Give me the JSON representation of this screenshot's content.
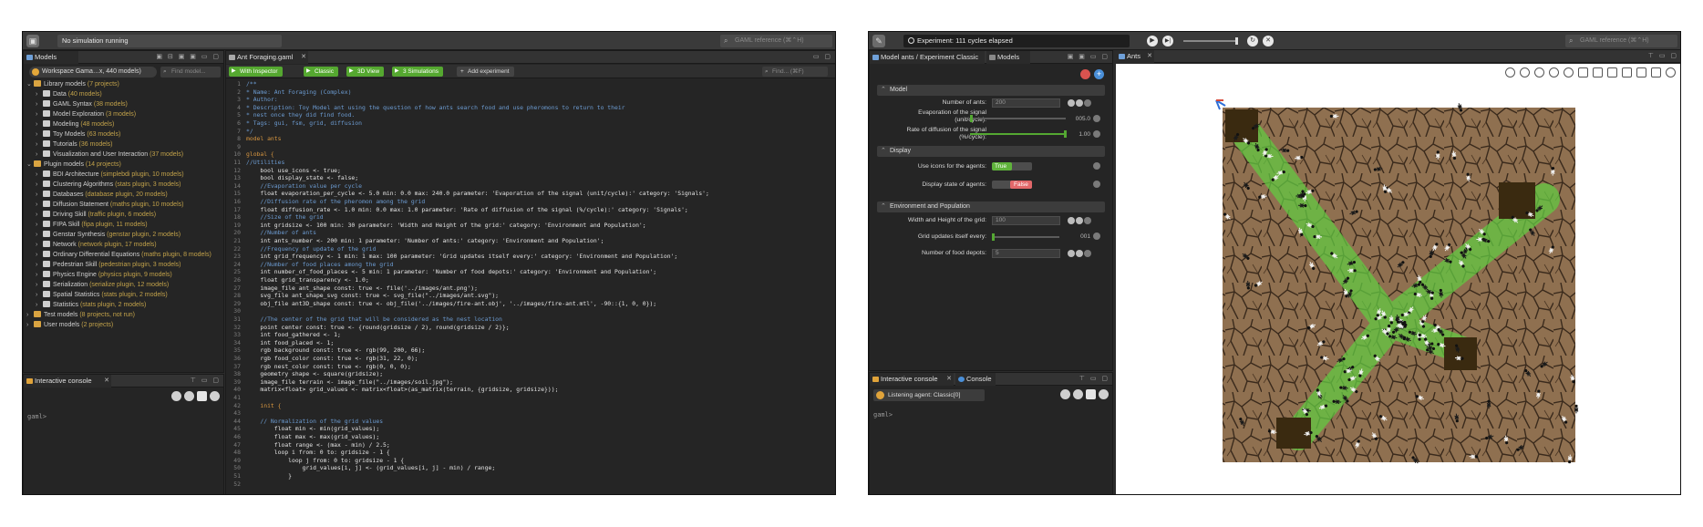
{
  "left_window": {
    "status": "No simulation running",
    "search_placeholder": "GAML reference (⌘⌃H)",
    "models_tab": "Models",
    "workspace": "Workspace Gama…x, 440 models)",
    "find_model_placeholder": "Find model...",
    "tree": [
      {
        "indent": 0,
        "twisty": "⌄",
        "label": "Library models",
        "count": "(7 projects)",
        "folder": true
      },
      {
        "indent": 1,
        "twisty": "›",
        "label": "Data",
        "count": "(40 models)"
      },
      {
        "indent": 1,
        "twisty": "›",
        "label": "GAML Syntax",
        "count": "(38 models)"
      },
      {
        "indent": 1,
        "twisty": "›",
        "label": "Model Exploration",
        "count": "(3 models)"
      },
      {
        "indent": 1,
        "twisty": "›",
        "label": "Modeling",
        "count": "(48 models)"
      },
      {
        "indent": 1,
        "twisty": "›",
        "label": "Toy Models",
        "count": "(63 models)"
      },
      {
        "indent": 1,
        "twisty": "›",
        "label": "Tutorials",
        "count": "(36 models)"
      },
      {
        "indent": 1,
        "twisty": "›",
        "label": "Visualization and User Interaction",
        "count": "(37 models)"
      },
      {
        "indent": 0,
        "twisty": "⌄",
        "label": "Plugin models",
        "count": "(14 projects)",
        "folder": true
      },
      {
        "indent": 1,
        "twisty": "›",
        "label": "BDI Architecture",
        "count": "(simplebdi plugin, 10 models)"
      },
      {
        "indent": 1,
        "twisty": "›",
        "label": "Clustering Algorithms",
        "count": "(stats plugin, 3 models)"
      },
      {
        "indent": 1,
        "twisty": "›",
        "label": "Databases",
        "count": "(database plugin, 20 models)"
      },
      {
        "indent": 1,
        "twisty": "›",
        "label": "Diffusion Statement",
        "count": "(maths plugin, 10 models)"
      },
      {
        "indent": 1,
        "twisty": "›",
        "label": "Driving Skill",
        "count": "(traffic plugin, 6 models)"
      },
      {
        "indent": 1,
        "twisty": "›",
        "label": "FIPA Skill",
        "count": "(fipa plugin, 11 models)"
      },
      {
        "indent": 1,
        "twisty": "›",
        "label": "Genstar Synthesis",
        "count": "(genstar plugin, 2 models)"
      },
      {
        "indent": 1,
        "twisty": "›",
        "label": "Network",
        "count": "(network plugin, 17 models)"
      },
      {
        "indent": 1,
        "twisty": "›",
        "label": "Ordinary Differential Equations",
        "count": "(maths plugin, 8 models)"
      },
      {
        "indent": 1,
        "twisty": "›",
        "label": "Pedestrian Skill",
        "count": "(pedestrian plugin, 3 models)"
      },
      {
        "indent": 1,
        "twisty": "›",
        "label": "Physics Engine",
        "count": "(physics plugin, 9 models)"
      },
      {
        "indent": 1,
        "twisty": "›",
        "label": "Serialization",
        "count": "(serialize plugin, 12 models)"
      },
      {
        "indent": 1,
        "twisty": "›",
        "label": "Spatial Statistics",
        "count": "(stats plugin, 2 models)"
      },
      {
        "indent": 1,
        "twisty": "›",
        "label": "Statistics",
        "count": "(stats plugin, 2 models)"
      },
      {
        "indent": 0,
        "twisty": "›",
        "label": "Test models",
        "count": "(8 projects, not run)",
        "folder": true
      },
      {
        "indent": 0,
        "twisty": "›",
        "label": "User models",
        "count": "(2 projects)",
        "folder": true
      }
    ],
    "console_tab": "Interactive console",
    "console_prompt": "gaml>",
    "editor_tab": "Ant Foraging.gaml",
    "experiments": [
      "With Inspector",
      "Classic",
      "3D View",
      "3 Simulations"
    ],
    "add_experiment": "Add experiment",
    "find_placeholder": "Find... (⌘F)",
    "code": [
      {
        "n": "1",
        "t": "/**",
        "c": "com"
      },
      {
        "n": "2",
        "t": "* Name: Ant Foraging (Complex)",
        "c": "com"
      },
      {
        "n": "3",
        "t": "* Author:",
        "c": "com"
      },
      {
        "n": "4",
        "t": "* Description: Toy Model ant using the question of how ants search food and use pheromons to return to their",
        "c": "com"
      },
      {
        "n": "5",
        "t": "* nest once they did find food.",
        "c": "com"
      },
      {
        "n": "6",
        "t": "* Tags: gui, fsm, grid, diffusion",
        "c": "com"
      },
      {
        "n": "7",
        "t": "*/",
        "c": "com"
      },
      {
        "n": "8",
        "t": "model ants",
        "c": "kw"
      },
      {
        "n": "9",
        "t": "",
        "c": "txt"
      },
      {
        "n": "10",
        "t": "global {",
        "c": "kw"
      },
      {
        "n": "11",
        "t": "//Utilities",
        "c": "com"
      },
      {
        "n": "12",
        "t": "    bool use_icons <- true;",
        "c": "txt"
      },
      {
        "n": "13",
        "t": "    bool display_state <- false;",
        "c": "txt"
      },
      {
        "n": "14",
        "t": "    //Evaporation value per cycle",
        "c": "com"
      },
      {
        "n": "15",
        "t": "    float evaporation_per_cycle <- 5.0 min: 0.0 max: 240.0 parameter: 'Evaporation of the signal (unit/cycle):' category: 'Signals';",
        "c": "txt"
      },
      {
        "n": "16",
        "t": "    //Diffusion rate of the pheromon among the grid",
        "c": "com"
      },
      {
        "n": "17",
        "t": "    float diffusion_rate <- 1.0 min: 0.0 max: 1.0 parameter: 'Rate of diffusion of the signal (%/cycle):' category: 'Signals';",
        "c": "txt"
      },
      {
        "n": "18",
        "t": "    //Size of the grid",
        "c": "com"
      },
      {
        "n": "19",
        "t": "    int gridsize <- 100 min: 30 parameter: 'Width and Height of the grid:' category: 'Environment and Population';",
        "c": "txt"
      },
      {
        "n": "20",
        "t": "    //Number of ants",
        "c": "com"
      },
      {
        "n": "21",
        "t": "    int ants_number <- 200 min: 1 parameter: 'Number of ants:' category: 'Environment and Population';",
        "c": "txt"
      },
      {
        "n": "22",
        "t": "    //Frequency of update of the grid",
        "c": "com"
      },
      {
        "n": "23",
        "t": "    int grid_frequency <- 1 min: 1 max: 100 parameter: 'Grid updates itself every:' category: 'Environment and Population';",
        "c": "txt"
      },
      {
        "n": "24",
        "t": "    //Number of food places among the grid",
        "c": "com"
      },
      {
        "n": "25",
        "t": "    int number_of_food_places <- 5 min: 1 parameter: 'Number of food depots:' category: 'Environment and Population';",
        "c": "txt"
      },
      {
        "n": "26",
        "t": "    float grid_transparency <- 1.0;",
        "c": "txt"
      },
      {
        "n": "27",
        "t": "    image_file ant_shape const: true <- file('../images/ant.png');",
        "c": "txt"
      },
      {
        "n": "28",
        "t": "    svg_file ant_shape_svg const: true <- svg_file(\"../images/ant.svg\");",
        "c": "txt"
      },
      {
        "n": "29",
        "t": "    obj_file ant3D_shape const: true <- obj_file('../images/fire-ant.obj', '../images/fire-ant.mtl', -90::{1, 0, 0});",
        "c": "txt"
      },
      {
        "n": "30",
        "t": "",
        "c": "txt"
      },
      {
        "n": "31",
        "t": "    //The center of the grid that will be considered as the nest location",
        "c": "com"
      },
      {
        "n": "32",
        "t": "    point center const: true <- {round(gridsize / 2), round(gridsize / 2)};",
        "c": "txt"
      },
      {
        "n": "33",
        "t": "    int food_gathered <- 1;",
        "c": "txt"
      },
      {
        "n": "34",
        "t": "    int food_placed <- 1;",
        "c": "txt"
      },
      {
        "n": "35",
        "t": "    rgb background const: true <- rgb(99, 200, 66);",
        "c": "txt"
      },
      {
        "n": "36",
        "t": "    rgb food_color const: true <- rgb(31, 22, 0);",
        "c": "txt"
      },
      {
        "n": "37",
        "t": "    rgb nest_color const: true <- rgb(0, 0, 0);",
        "c": "txt"
      },
      {
        "n": "38",
        "t": "    geometry shape <- square(gridsize);",
        "c": "txt"
      },
      {
        "n": "39",
        "t": "    image_file terrain <- image_file(\"../images/soil.jpg\");",
        "c": "txt"
      },
      {
        "n": "40",
        "t": "    matrix<float> grid_values <- matrix<float>(as_matrix(terrain, {gridsize, gridsize}));",
        "c": "txt"
      },
      {
        "n": "41",
        "t": "",
        "c": "txt"
      },
      {
        "n": "42",
        "t": "    init {",
        "c": "kw"
      },
      {
        "n": "43",
        "t": "",
        "c": "txt"
      },
      {
        "n": "44",
        "t": "    // Normalization of the grid values",
        "c": "com"
      },
      {
        "n": "45",
        "t": "        float min <- min(grid_values);",
        "c": "txt"
      },
      {
        "n": "46",
        "t": "        float max <- max(grid_values);",
        "c": "txt"
      },
      {
        "n": "47",
        "t": "        float range <- (max - min) / 2.5;",
        "c": "txt"
      },
      {
        "n": "48",
        "t": "        loop i from: 0 to: gridsize - 1 {",
        "c": "txt"
      },
      {
        "n": "49",
        "t": "            loop j from: 0 to: gridsize - 1 {",
        "c": "txt"
      },
      {
        "n": "50",
        "t": "                grid_values[i, j] <- (grid_values[i, j] - min) / range;",
        "c": "txt"
      },
      {
        "n": "51",
        "t": "            }",
        "c": "txt"
      },
      {
        "n": "52",
        "t": "",
        "c": "txt"
      }
    ]
  },
  "right_window": {
    "status": "Experiment: 111 cycles elapsed",
    "search_placeholder": "GAML reference (⌘⌃H)",
    "params_tab": "Model ants / Experiment Classic",
    "models_tab": "Models",
    "display_tab": "Ants",
    "sections": {
      "model": "Model",
      "display": "Display",
      "environment": "Environment and Population"
    },
    "params": {
      "number_of_ants_label": "Number of ants:",
      "number_of_ants_value": "200",
      "evaporation_label": "Evaporation of the signal (unit/cycle):",
      "evaporation_value": "005.0",
      "evaporation_fraction": 0.02,
      "diffusion_label": "Rate of diffusion of the signal (%/cycle):",
      "diffusion_value": "1.00",
      "diffusion_fraction": 1.0,
      "use_icons_label": "Use icons for the agents:",
      "use_icons_value": "True",
      "display_state_label": "Display state of agents:",
      "display_state_value": "False",
      "grid_size_label": "Width and Height of the grid:",
      "grid_size_value": "100",
      "grid_updates_label": "Grid updates itself every:",
      "grid_updates_value": "001",
      "grid_updates_fraction": 0.0,
      "food_depots_label": "Number of food depots:",
      "food_depots_value": "5"
    },
    "console_tab": "Interactive console",
    "console_tab2": "Console",
    "listening_agent": "Listening agent: Classic[0]",
    "console_prompt": "gaml>"
  },
  "colors": {
    "accent_green": "#55a830",
    "pheromone_green": "#63c842",
    "soil": "#8a6a4a",
    "food": "#3a2a10",
    "false_red": "#e2686a"
  }
}
